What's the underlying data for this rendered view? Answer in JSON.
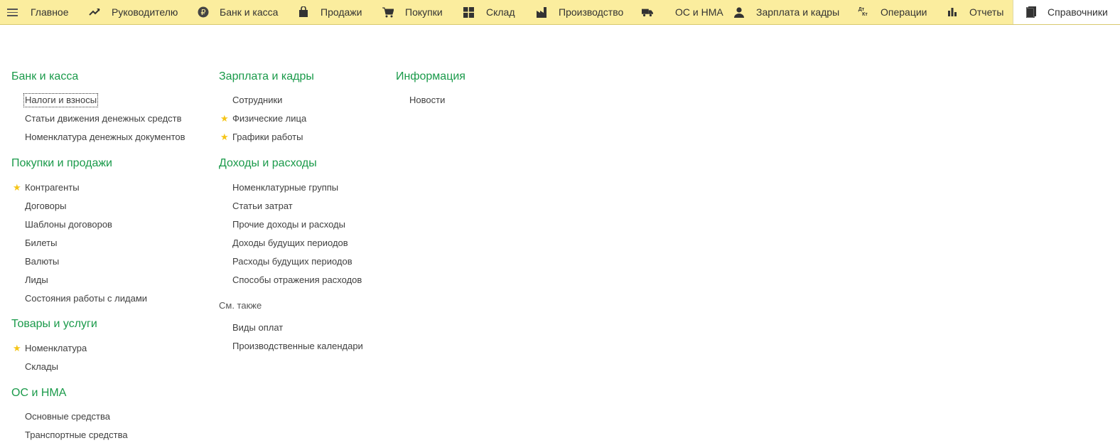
{
  "nav": {
    "items": [
      {
        "label": "Главное",
        "icon": "menu-icon"
      },
      {
        "label": "Руководителю",
        "icon": "trend-up-icon"
      },
      {
        "label": "Банк и касса",
        "icon": "ruble-coin-icon"
      },
      {
        "label": "Продажи",
        "icon": "shopping-bag-icon"
      },
      {
        "label": "Покупки",
        "icon": "cart-icon"
      },
      {
        "label": "Склад",
        "icon": "warehouse-grid-icon"
      },
      {
        "label": "Производство",
        "icon": "factory-icon"
      },
      {
        "label": "ОС и НМА",
        "icon": "truck-icon"
      },
      {
        "label": "Зарплата и кадры",
        "icon": "person-icon"
      },
      {
        "label": "Операции",
        "icon": "dt-kt-icon"
      },
      {
        "label": "Отчеты",
        "icon": "bar-chart-icon"
      },
      {
        "label": "Справочники",
        "icon": "books-icon",
        "active": true
      }
    ],
    "dt_kt": {
      "top": "Дт",
      "bottom": "Кт"
    }
  },
  "colors": {
    "topbar": "#fbed9e",
    "section_title": "#1a9a4a",
    "star": "#f5c518"
  },
  "sections": {
    "bank": {
      "title": "Банк и касса",
      "items": [
        "Налоги и взносы",
        "Статьи движения денежных средств",
        "Номенклатура денежных документов"
      ]
    },
    "sales": {
      "title": "Покупки и продажи",
      "items": [
        "Контрагенты",
        "Договоры",
        "Шаблоны договоров",
        "Билеты",
        "Валюты",
        "Лиды",
        "Состояния работы с лидами"
      ]
    },
    "goods": {
      "title": "Товары и услуги",
      "items": [
        "Номенклатура",
        "Склады"
      ]
    },
    "os": {
      "title": "ОС и НМА",
      "items": [
        "Основные средства",
        "Транспортные средства"
      ]
    },
    "salary": {
      "title": "Зарплата и кадры",
      "items": [
        "Сотрудники",
        "Физические лица",
        "Графики работы"
      ]
    },
    "income": {
      "title": "Доходы и расходы",
      "items": [
        "Номенклатурные группы",
        "Статьи затрат",
        "Прочие доходы и расходы",
        "Доходы будущих периодов",
        "Расходы будущих периодов",
        "Способы отражения расходов"
      ]
    },
    "see_also": {
      "title": "См. также",
      "items": [
        "Виды оплат",
        "Производственные календари"
      ]
    },
    "info": {
      "title": "Информация",
      "items": [
        "Новости"
      ]
    }
  }
}
